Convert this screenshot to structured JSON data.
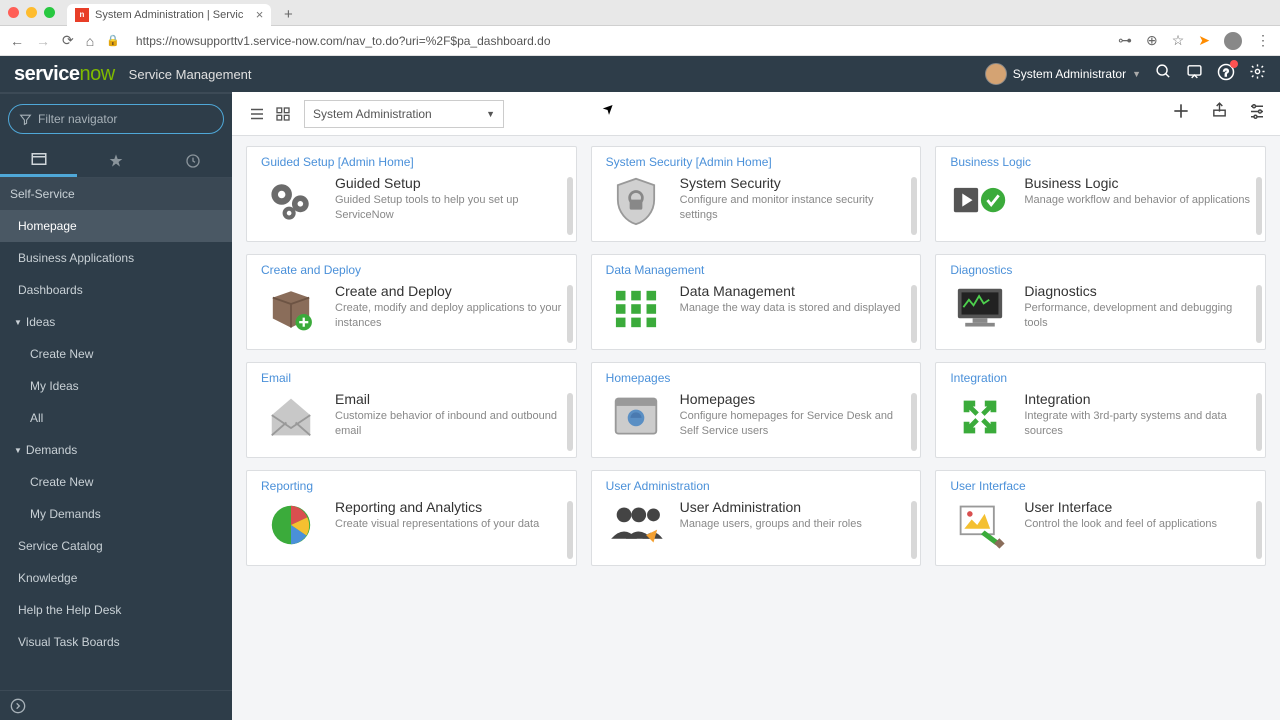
{
  "browser": {
    "tab_title": "System Administration | Servic",
    "url": "https://nowsupporttv1.service-now.com/nav_to.do?uri=%2F$pa_dashboard.do"
  },
  "header": {
    "logo_service": "service",
    "logo_now": "now",
    "subtitle": "Service Management",
    "user": "System Administrator"
  },
  "sidebar": {
    "filter_placeholder": "Filter navigator",
    "items": [
      {
        "type": "section",
        "label": "Self-Service"
      },
      {
        "type": "item",
        "label": "Homepage",
        "active": true
      },
      {
        "type": "item",
        "label": "Business Applications"
      },
      {
        "type": "item",
        "label": "Dashboards"
      },
      {
        "type": "expand",
        "label": "Ideas"
      },
      {
        "type": "sub",
        "label": "Create New"
      },
      {
        "type": "sub",
        "label": "My Ideas"
      },
      {
        "type": "sub",
        "label": "All"
      },
      {
        "type": "expand",
        "label": "Demands"
      },
      {
        "type": "sub",
        "label": "Create New"
      },
      {
        "type": "sub",
        "label": "My Demands"
      },
      {
        "type": "item",
        "label": "Service Catalog"
      },
      {
        "type": "item",
        "label": "Knowledge"
      },
      {
        "type": "item",
        "label": "Help the Help Desk"
      },
      {
        "type": "item",
        "label": "Visual Task Boards"
      }
    ]
  },
  "toolbar": {
    "selected": "System Administration"
  },
  "cards": [
    {
      "link": "Guided Setup [Admin Home]",
      "title": "Guided Setup",
      "desc": "Guided Setup tools to help you set up ServiceNow",
      "icon": "gears"
    },
    {
      "link": "System Security [Admin Home]",
      "title": "System Security",
      "desc": "Configure and monitor instance security settings",
      "icon": "shield"
    },
    {
      "link": "Business Logic",
      "title": "Business Logic",
      "desc": "Manage workflow and behavior of applications",
      "icon": "play"
    },
    {
      "link": "Create and Deploy",
      "title": "Create and Deploy",
      "desc": "Create, modify and deploy applications to your instances",
      "icon": "box"
    },
    {
      "link": "Data Management",
      "title": "Data Management",
      "desc": "Manage the way data is stored and displayed",
      "icon": "grid"
    },
    {
      "link": "Diagnostics",
      "title": "Diagnostics",
      "desc": "Performance, development and debugging tools",
      "icon": "monitor"
    },
    {
      "link": "Email",
      "title": "Email",
      "desc": "Customize behavior of inbound and outbound email",
      "icon": "envelope"
    },
    {
      "link": "Homepages",
      "title": "Homepages",
      "desc": "Configure homepages for Service Desk and Self Service users",
      "icon": "homepage"
    },
    {
      "link": "Integration",
      "title": "Integration",
      "desc": "Integrate with 3rd-party systems and data sources",
      "icon": "arrows"
    },
    {
      "link": "Reporting",
      "title": "Reporting and Analytics",
      "desc": "Create visual representations of your data",
      "icon": "pie"
    },
    {
      "link": "User Administration",
      "title": "User Administration",
      "desc": "Manage users, groups and their roles",
      "icon": "users"
    },
    {
      "link": "User Interface",
      "title": "User Interface",
      "desc": "Control the look and feel of applications",
      "icon": "palette"
    }
  ]
}
